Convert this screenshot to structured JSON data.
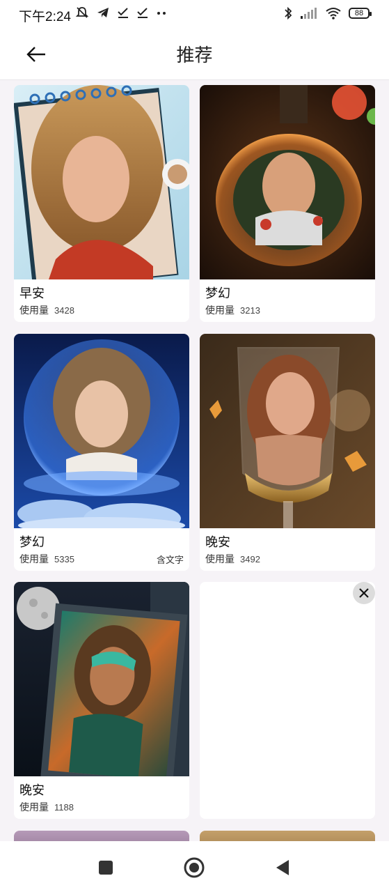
{
  "status_bar": {
    "time": "下午2:24",
    "battery": "88",
    "left_icons": [
      "mute-icon",
      "telegram-icon",
      "check-icon",
      "check-icon",
      "more-dots-icon"
    ],
    "right_icons": [
      "bluetooth-icon",
      "signal-icon",
      "wifi-icon",
      "battery-icon"
    ]
  },
  "header": {
    "title": "推荐",
    "back_icon": "arrow-left-icon"
  },
  "cards": [
    {
      "name": "早安",
      "usage_label": "使用量",
      "count": "3428",
      "tag": ""
    },
    {
      "name": "梦幻",
      "usage_label": "使用量",
      "count": "3213",
      "tag": ""
    },
    {
      "name": "梦幻",
      "usage_label": "使用量",
      "count": "5335",
      "tag": "含文字"
    },
    {
      "name": "晚安",
      "usage_label": "使用量",
      "count": "3492",
      "tag": ""
    },
    {
      "name": "晚安",
      "usage_label": "使用量",
      "count": "1188",
      "tag": ""
    }
  ],
  "ad": {
    "close_icon": "close-icon"
  },
  "nav_bar": {
    "icons": [
      "recents-square-icon",
      "home-circle-icon",
      "back-triangle-icon"
    ]
  },
  "colors": {
    "background": "#f6f3f7",
    "card": "#ffffff",
    "text": "#111111"
  }
}
